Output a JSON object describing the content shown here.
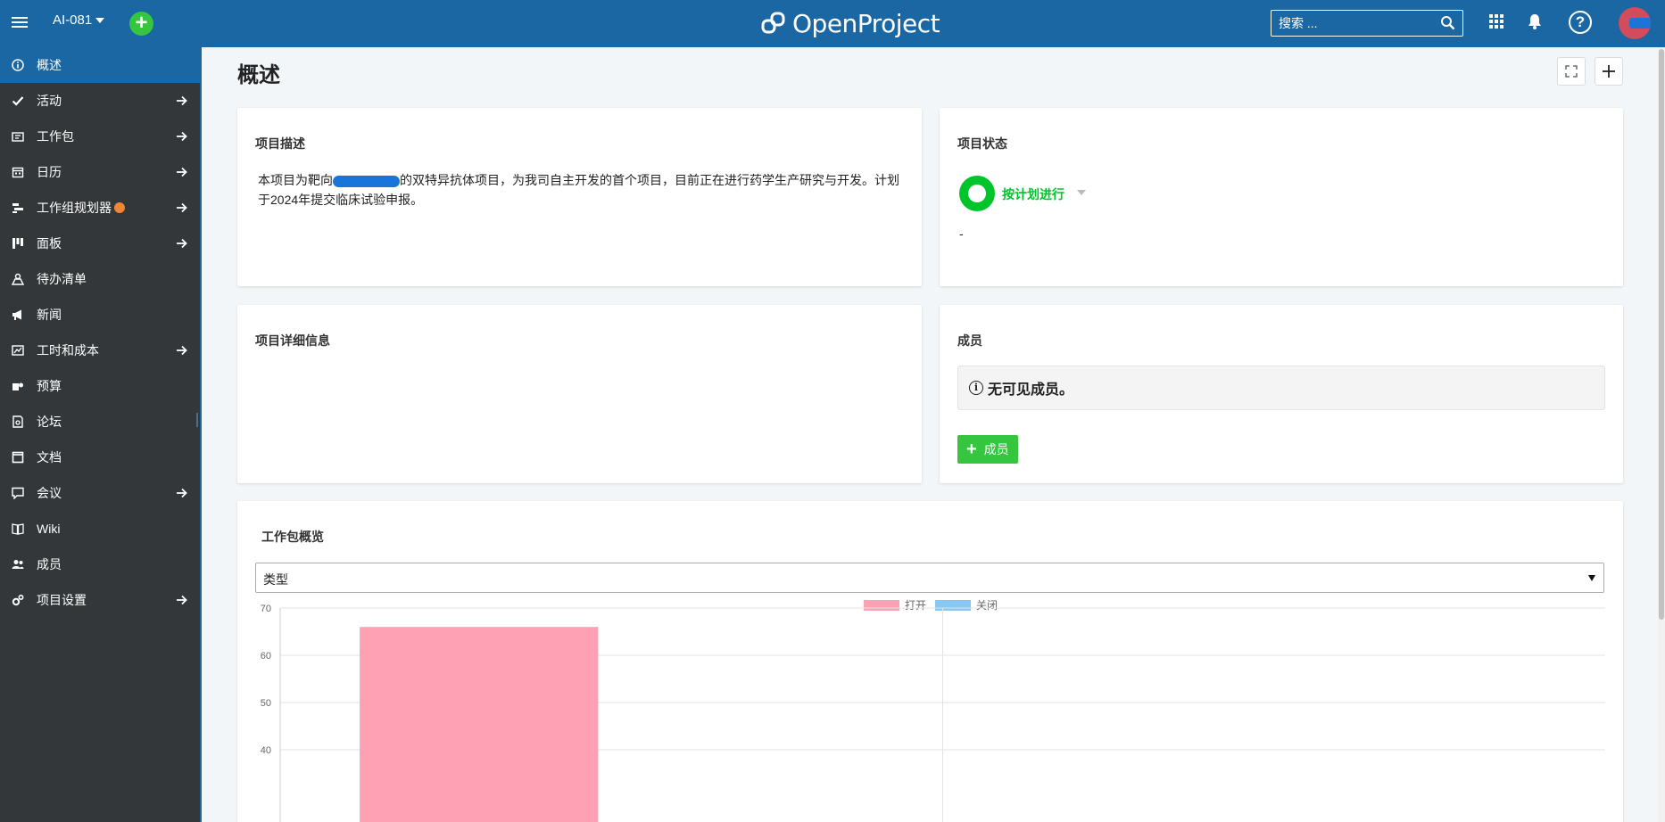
{
  "header": {
    "project": "AI-081",
    "logo_text": "OpenProject",
    "search_placeholder": "搜索 ..."
  },
  "sidebar": {
    "items": [
      {
        "label": "概述",
        "icon": "info-icon",
        "arrow": false,
        "active": true
      },
      {
        "label": "活动",
        "icon": "check-icon",
        "arrow": true
      },
      {
        "label": "工作包",
        "icon": "work-packages-icon",
        "arrow": true
      },
      {
        "label": "日历",
        "icon": "calendar-icon",
        "arrow": true
      },
      {
        "label": "工作组规划器",
        "icon": "team-planner-icon",
        "arrow": true,
        "badge": true
      },
      {
        "label": "面板",
        "icon": "boards-icon",
        "arrow": true
      },
      {
        "label": "待办清单",
        "icon": "backlogs-icon",
        "arrow": false
      },
      {
        "label": "新闻",
        "icon": "megaphone-icon",
        "arrow": false
      },
      {
        "label": "工时和成本",
        "icon": "cost-reports-icon",
        "arrow": true
      },
      {
        "label": "预算",
        "icon": "budget-icon",
        "arrow": false
      },
      {
        "label": "论坛",
        "icon": "forum-icon",
        "arrow": false
      },
      {
        "label": "文档",
        "icon": "document-icon",
        "arrow": false
      },
      {
        "label": "会议",
        "icon": "meetings-icon",
        "arrow": true
      },
      {
        "label": "Wiki",
        "icon": "wiki-icon",
        "arrow": false
      },
      {
        "label": "成员",
        "icon": "members-icon",
        "arrow": false
      },
      {
        "label": "项目设置",
        "icon": "settings-icon",
        "arrow": true
      }
    ]
  },
  "main": {
    "title": "概述",
    "description": {
      "title": "项目描述",
      "text_a": "本项目为靶向",
      "text_b": "的双特异抗体项目，为我司自主开发的首个项目，目前正在进行药学生产研究与开发。计划于2024年提交临床试验申报。"
    },
    "status": {
      "title": "项目状态",
      "label": "按计划进行",
      "note": "-",
      "color": "#00c52a"
    },
    "details": {
      "title": "项目详细信息"
    },
    "members": {
      "title": "成员",
      "notice": "无可见成员。",
      "add_button": "成员"
    },
    "wp_overview": {
      "title": "工作包概览",
      "select_value": "类型"
    }
  },
  "chart_data": {
    "type": "bar",
    "categories": [
      "",
      ""
    ],
    "series": [
      {
        "name": "打开",
        "values": [
          66,
          0
        ],
        "color": "#ffa1b5"
      },
      {
        "name": "关闭",
        "values": [
          0,
          0
        ],
        "color": "#86c7f3"
      }
    ],
    "data_labels": [
      "66"
    ],
    "yticks": [
      40,
      50,
      60,
      70
    ],
    "ylim": [
      0,
      70
    ],
    "legend": "top-center",
    "grid": true
  }
}
